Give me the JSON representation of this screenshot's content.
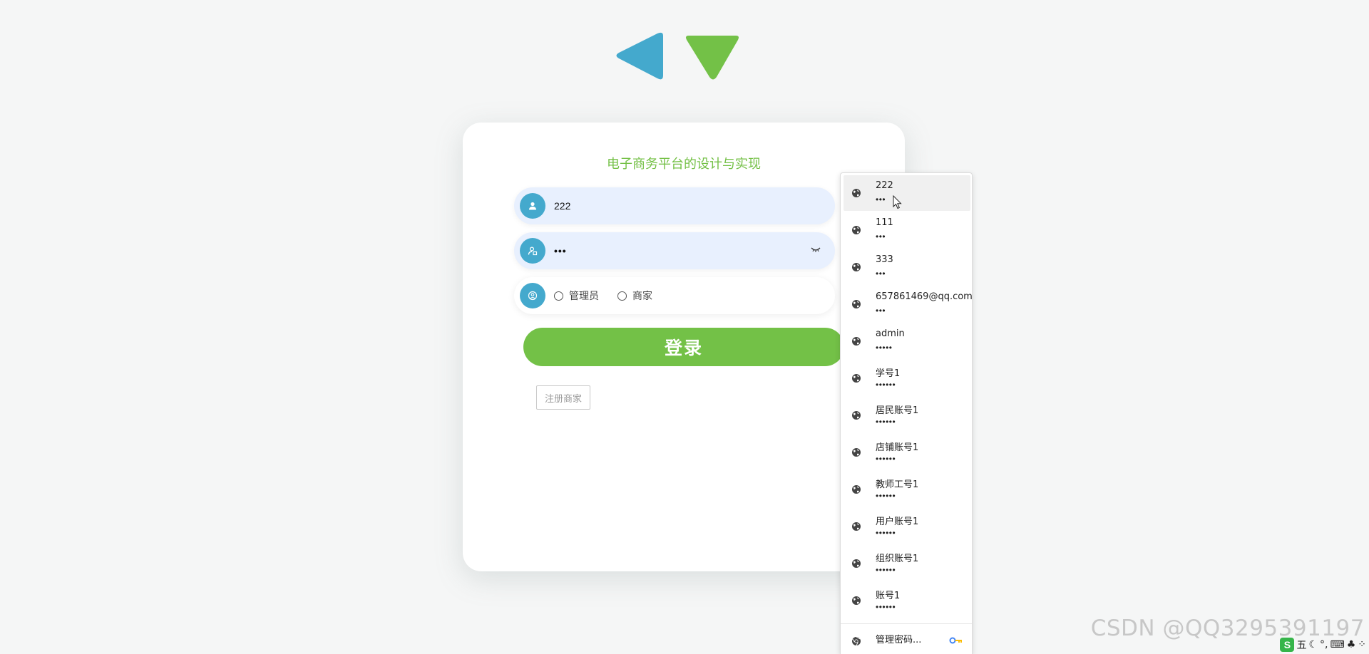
{
  "app": {
    "title": "电子商务平台的设计与实现",
    "accent_color": "#73c147",
    "icon_color": "#44a9cd"
  },
  "logo": {
    "left_shape": "blue-triangle",
    "right_shape": "green-triangle"
  },
  "form": {
    "username_value": "222",
    "password_value": "•••",
    "username_icon": "user-icon",
    "password_icon": "lock-user-icon",
    "role_icon": "role-icon",
    "roles": [
      "管理员",
      "商家"
    ],
    "login_label": "登录",
    "register_label": "注册商家"
  },
  "autofill": {
    "items": [
      {
        "name": "222",
        "pass": "•••"
      },
      {
        "name": "111",
        "pass": "•••"
      },
      {
        "name": "333",
        "pass": "•••"
      },
      {
        "name": "657861469@qq.com",
        "pass": "•••"
      },
      {
        "name": "admin",
        "pass": "•••••"
      },
      {
        "name": "学号1",
        "pass": "••••••"
      },
      {
        "name": "居民账号1",
        "pass": "••••••"
      },
      {
        "name": "店铺账号1",
        "pass": "••••••"
      },
      {
        "name": "教师工号1",
        "pass": "••••••"
      },
      {
        "name": "用户账号1",
        "pass": "••••••"
      },
      {
        "name": "组织账号1",
        "pass": "••••••"
      },
      {
        "name": "账号1",
        "pass": "••••••"
      }
    ],
    "manage_label": "管理密码..."
  },
  "watermark": "CSDN @QQ3295391197",
  "ime": {
    "logo": "S",
    "mode": "五"
  }
}
